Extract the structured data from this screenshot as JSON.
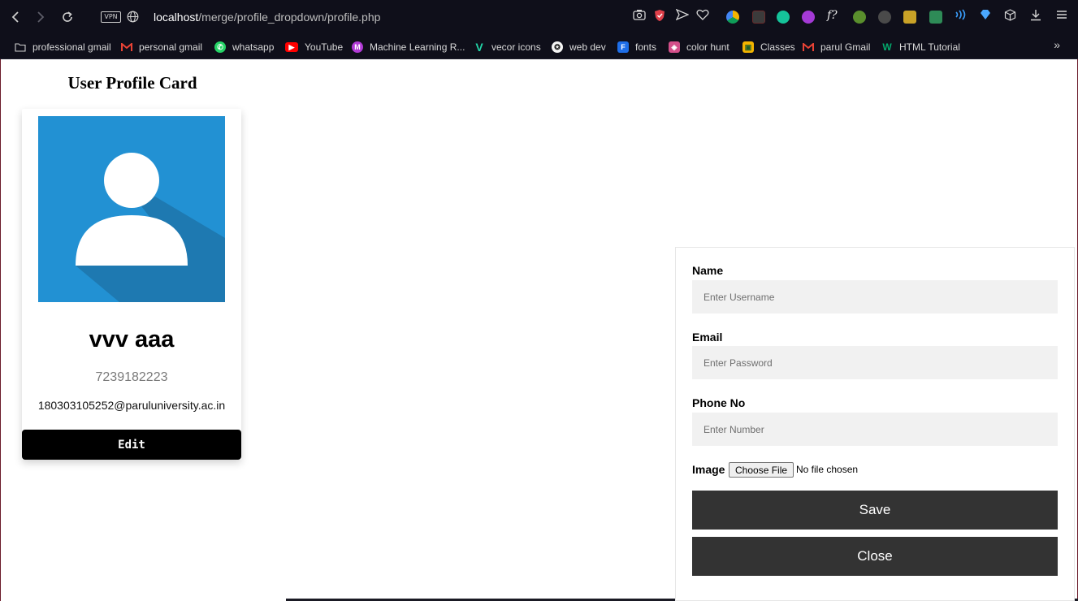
{
  "browser": {
    "vpn_label": "VPN",
    "url_host": "localhost",
    "url_path": "/merge/profile_dropdown/profile.php",
    "bookmarks": [
      {
        "label": "professional gmail",
        "icon": "folder-icon"
      },
      {
        "label": "personal gmail",
        "icon": "gmail-icon"
      },
      {
        "label": "whatsapp",
        "icon": "whatsapp-icon"
      },
      {
        "label": "YouTube",
        "icon": "youtube-icon"
      },
      {
        "label": "Machine Learning R...",
        "icon": "m-circle-icon"
      },
      {
        "label": "vecor icons",
        "icon": "v-logo-icon"
      },
      {
        "label": "web dev",
        "icon": "web-dev-icon"
      },
      {
        "label": "fonts",
        "icon": "fonts-icon"
      },
      {
        "label": "color hunt",
        "icon": "color-hunt-icon"
      },
      {
        "label": "Classes",
        "icon": "classroom-icon"
      },
      {
        "label": "parul Gmail",
        "icon": "gmail-icon"
      },
      {
        "label": "HTML Tutorial",
        "icon": "w3schools-icon"
      }
    ]
  },
  "profile": {
    "title": "User Profile Card",
    "name": "vvv aaa",
    "phone": "7239182223",
    "email": "180303105252@paruluniversity.ac.in",
    "edit_label": "Edit"
  },
  "form": {
    "name_label": "Name",
    "name_placeholder": "Enter Username",
    "email_label": "Email",
    "email_placeholder": "Enter Password",
    "phone_label": "Phone No",
    "phone_placeholder": "Enter Number",
    "image_label": "Image",
    "file_button_label": "Choose File",
    "file_status": "No file chosen",
    "save_label": "Save",
    "close_label": "Close"
  },
  "colors": {
    "avatar_bg": "#2291d3",
    "button_dark": "#333333",
    "edit_button": "#000000",
    "input_bg": "#f1f1f1"
  }
}
